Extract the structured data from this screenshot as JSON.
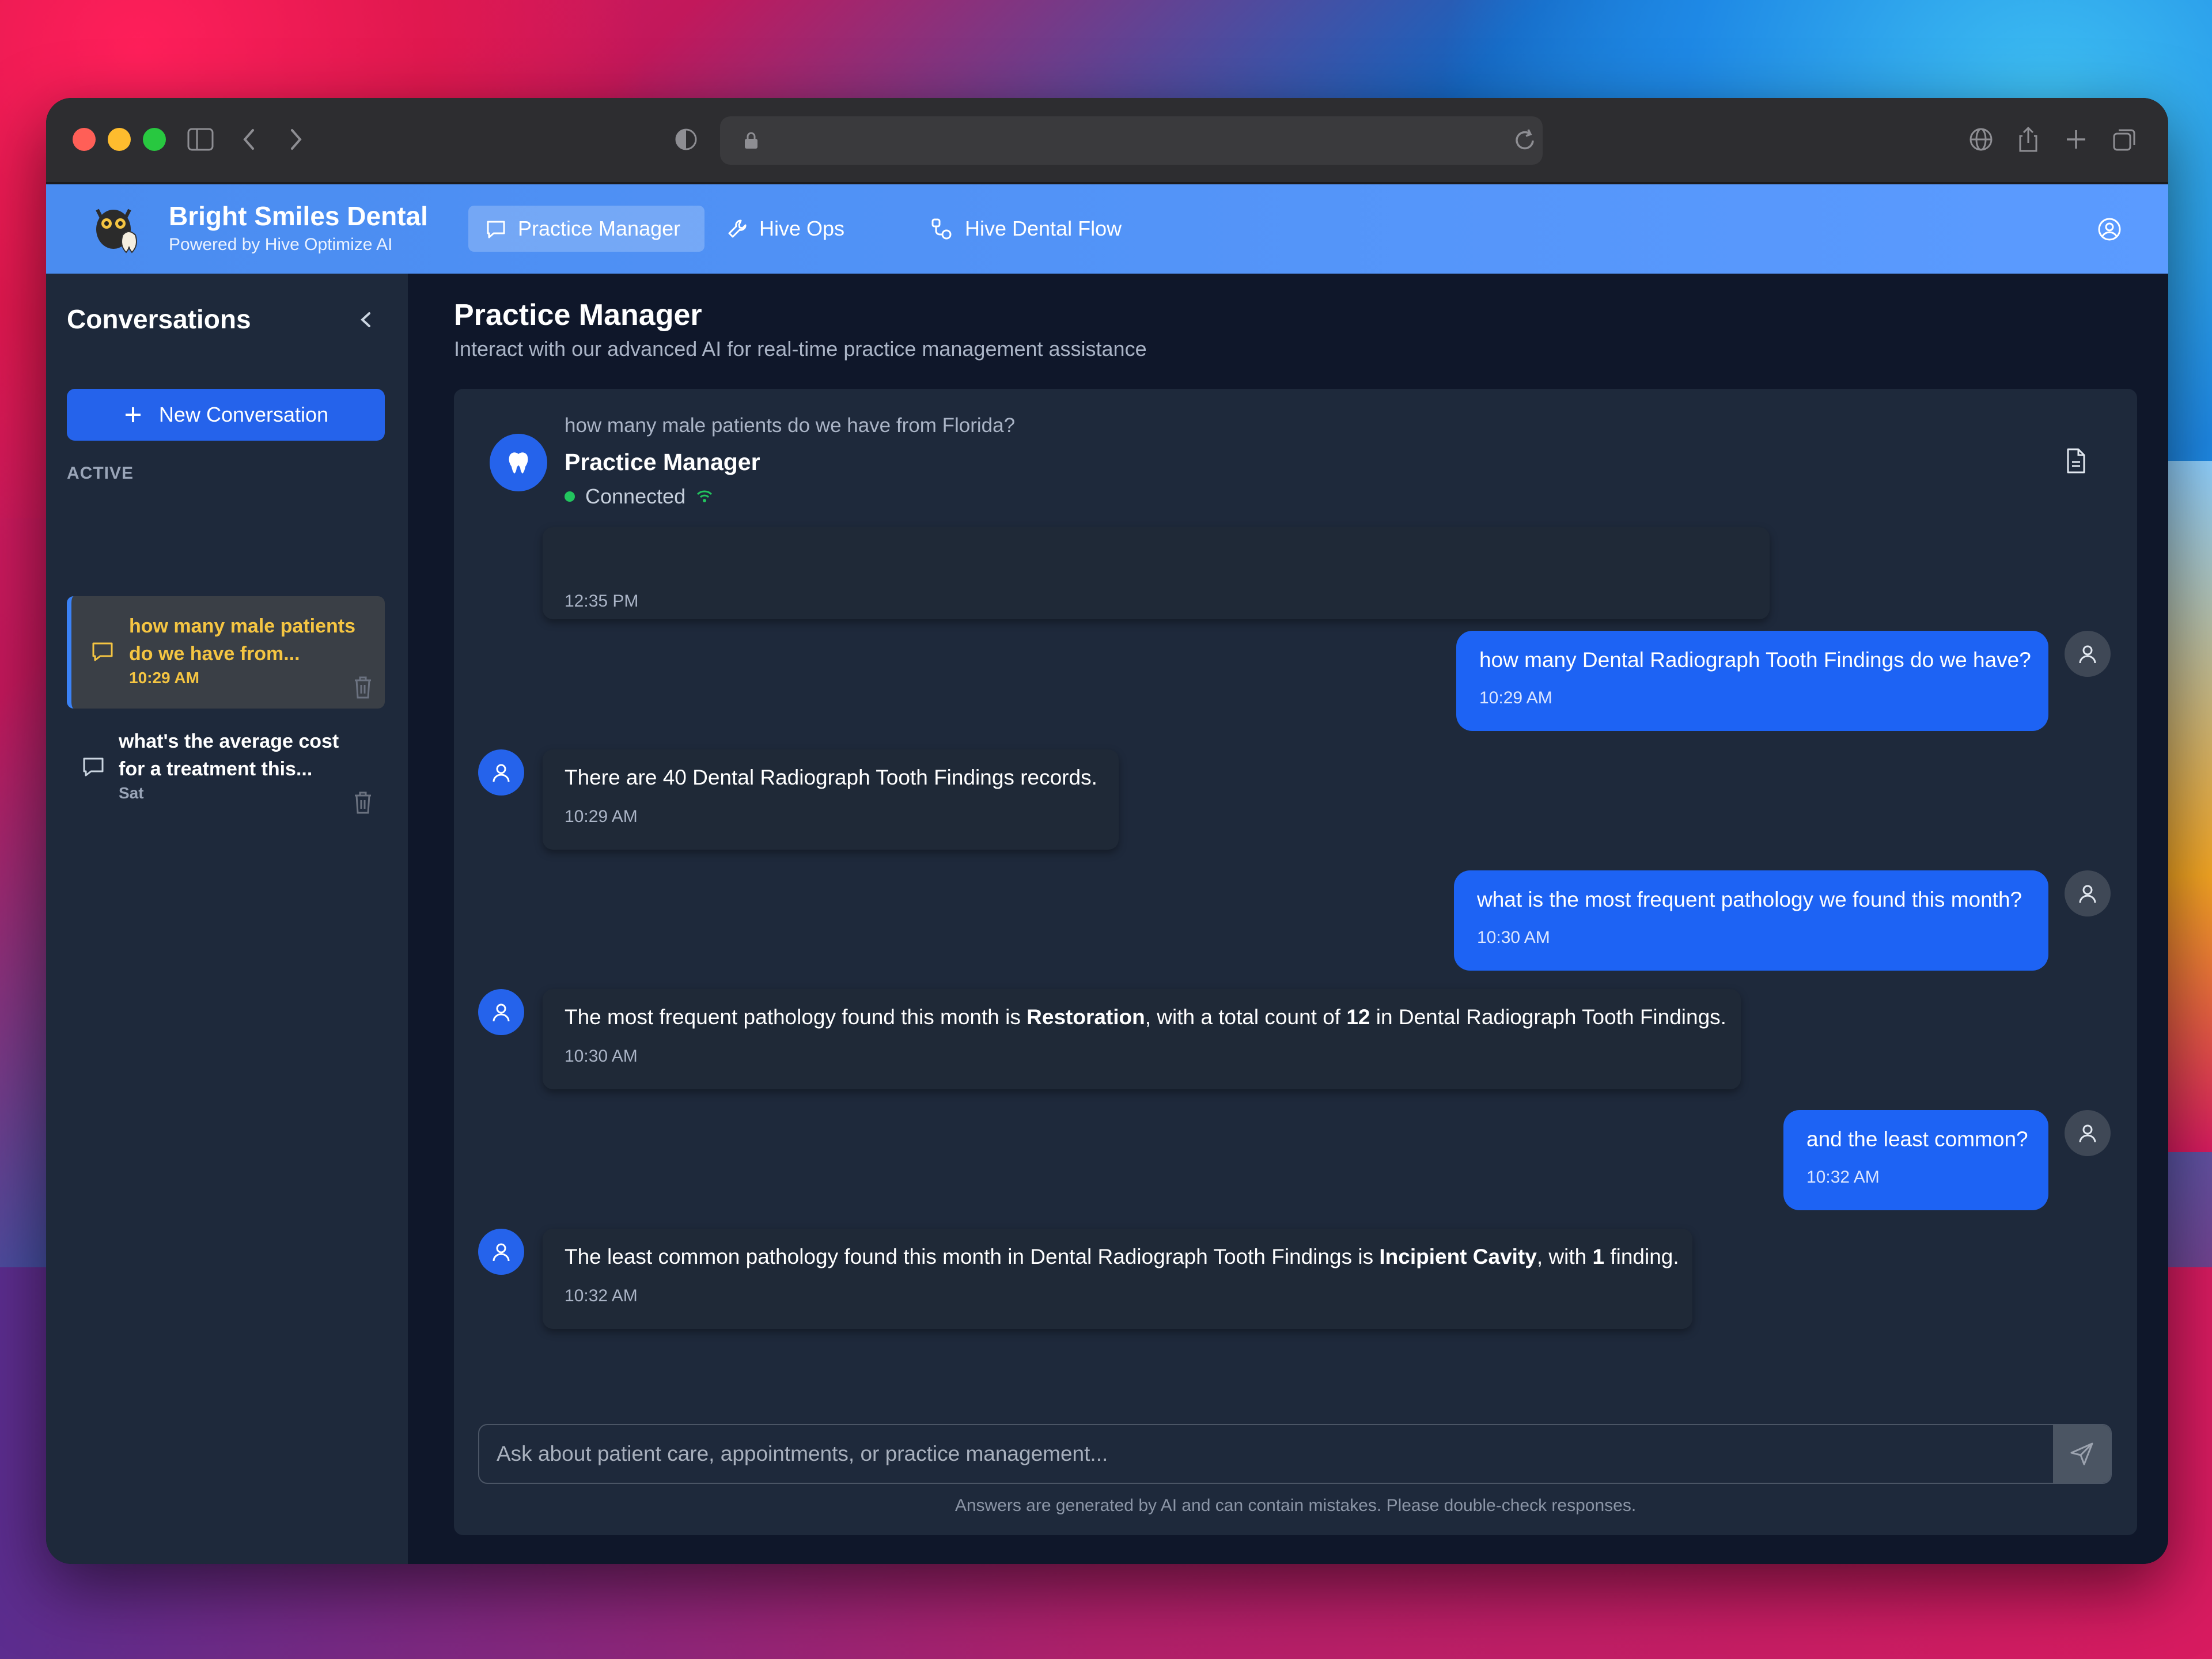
{
  "brand": {
    "name": "Bright Smiles Dental",
    "subtitle": "Powered by Hive Optimize AI"
  },
  "nav": {
    "tabs": [
      {
        "label": "Practice Manager",
        "icon": "chat-icon",
        "active": true
      },
      {
        "label": "Hive Ops",
        "icon": "wrench-icon",
        "active": false
      },
      {
        "label": "Hive Dental Flow",
        "icon": "flow-icon",
        "active": false
      }
    ]
  },
  "sidebar": {
    "title": "Conversations",
    "new_button": "New Conversation",
    "section_label": "ACTIVE",
    "conversations": [
      {
        "title_line1": "how many male patients",
        "title_line2": "do we have from...",
        "time": "10:29 AM",
        "active": true
      },
      {
        "title_line1": "what's the average cost",
        "title_line2": "for a treatment this...",
        "time": "Sat",
        "active": false
      }
    ]
  },
  "main": {
    "title": "Practice Manager",
    "subtitle": "Interact with our advanced AI for real-time practice management assistance"
  },
  "chat_header": {
    "question": "how many male patients do we have from Florida?",
    "name": "Practice Manager",
    "status": "Connected",
    "avatar_icon": "tooth-icon"
  },
  "messages": {
    "m0": {
      "time": "12:35 PM"
    },
    "m1": {
      "text": "how many Dental Radiograph Tooth Findings do we have?",
      "time": "10:29 AM"
    },
    "m2": {
      "text": "There are 40 Dental Radiograph Tooth Findings records.",
      "time": "10:29 AM"
    },
    "m3": {
      "text": "what is the most frequent pathology we found this month?",
      "time": "10:30 AM"
    },
    "m4": {
      "pre": "The most frequent pathology found this month is ",
      "b1": "Restoration",
      "mid": ", with a total count of ",
      "b2": "12",
      "post": " in Dental Radiograph Tooth Findings.",
      "time": "10:30 AM"
    },
    "m5": {
      "text": "and the least common?",
      "time": "10:32 AM"
    },
    "m6": {
      "pre": "The least common pathology found this month in Dental Radiograph Tooth Findings is ",
      "b1": "Incipient Cavity",
      "mid": ", with ",
      "b2": "1",
      "post": " finding.",
      "time": "10:32 AM"
    }
  },
  "input": {
    "placeholder": "Ask about patient care, appointments, or practice management..."
  },
  "disclaimer": "Answers are generated by AI and can contain mistakes. Please double-check responses.",
  "colors": {
    "header": "#4a8cf0",
    "accent": "#1d63f4",
    "active_title": "#f5c542",
    "status": "#22c55e"
  }
}
